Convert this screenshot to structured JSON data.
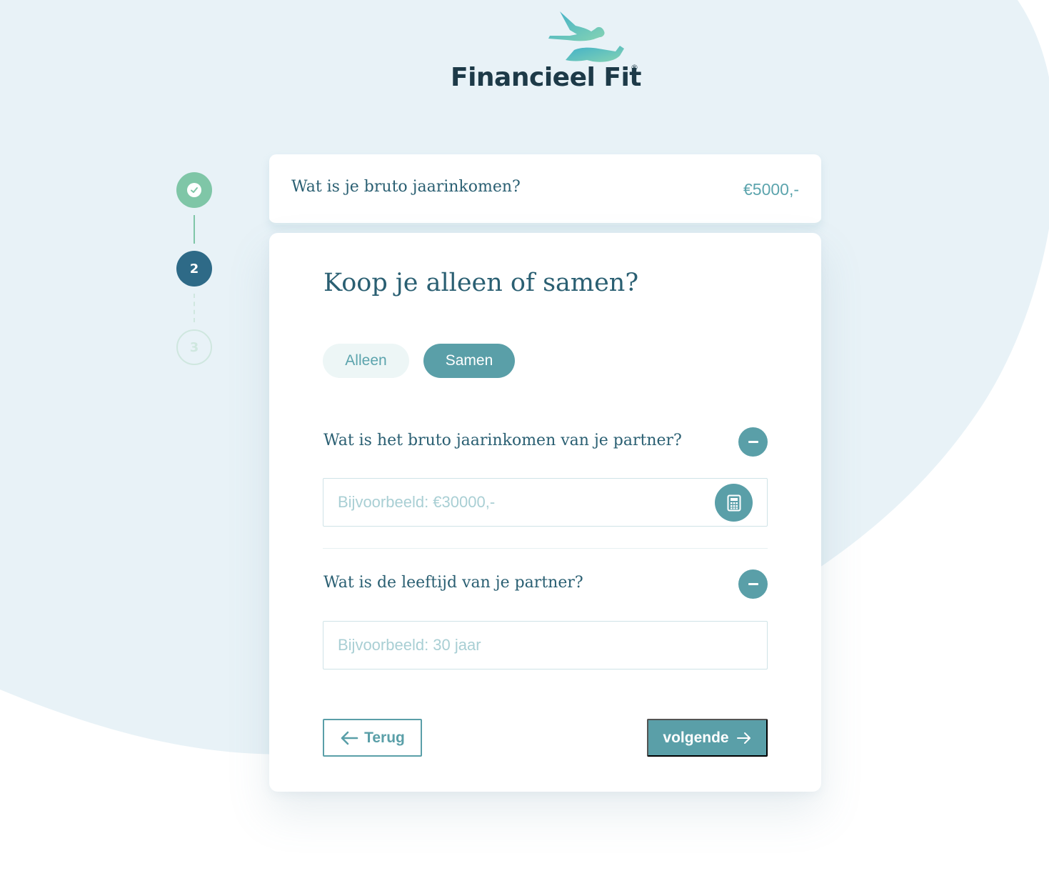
{
  "brand": {
    "name": "Financieel Fit",
    "registered_mark": "®"
  },
  "stepper": {
    "steps": [
      {
        "label": "",
        "state": "completed",
        "icon": "check-icon"
      },
      {
        "label": "2",
        "state": "active"
      },
      {
        "label": "3",
        "state": "upcoming"
      }
    ]
  },
  "summary": {
    "question": "Wat is je bruto jaarinkomen?",
    "value": "€5000,-"
  },
  "form": {
    "title": "Koop je alleen of samen?",
    "options": [
      {
        "label": "Alleen",
        "selected": false
      },
      {
        "label": "Samen",
        "selected": true
      }
    ],
    "partner_income": {
      "question": "Wat is het bruto jaarinkomen van je partner?",
      "value": "",
      "placeholder": "Bijvoorbeeld: €30000,-",
      "collapse_icon": "minus-icon",
      "calculator_icon": "calculator-icon"
    },
    "partner_age": {
      "question": "Wat is de leeftijd van je partner?",
      "value": "",
      "placeholder": "Bijvoorbeeld: 30 jaar",
      "collapse_icon": "minus-icon"
    },
    "back_label": "Terug",
    "next_label": "volgende"
  },
  "colors": {
    "accent": "#5a9fa8",
    "dark": "#2a5f72",
    "step_done": "#7fc6a7",
    "step_active": "#2e6a87",
    "background_blob": "#e8f2f7"
  }
}
